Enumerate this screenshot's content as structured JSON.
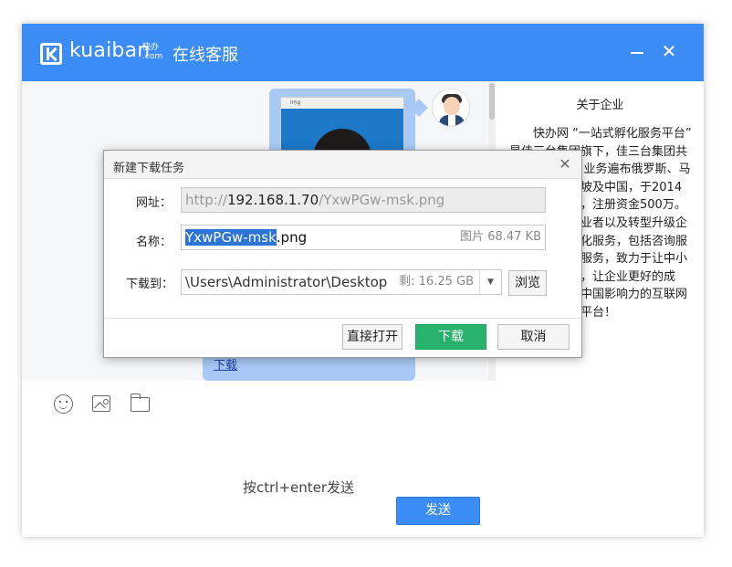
{
  "app": {
    "logo_text": "kuaiban",
    "logo_sub_line1": "快办",
    "logo_sub_line2": ".com",
    "title": "在线客服",
    "accent": "#3b8cf4"
  },
  "chat": {
    "image_window_title": "img",
    "link_text": "下载"
  },
  "about": {
    "title": "关于企业",
    "body": "快办网 “一站式孵化服务平台” 是佳三台集团旗下，佳三台集团共12家子公司，业务遍布俄罗斯、马来西亚、新加坡及中国，于2014年在上海成立，注册资金500万。平台为行业创业者以及转型升级企业提供定位孵化服务，包括咨询服务、企业孵化服务，致力于让中小企业良性发展，让企业更好的成长，成为具有中国影响力的互联网企业孵化服务平台！"
  },
  "toolbar": {
    "icons": [
      "smile-icon",
      "picture-icon",
      "folder-icon"
    ]
  },
  "composer": {
    "hint": "按ctrl+enter发送",
    "send_label": "发送"
  },
  "dialog": {
    "title": "新建下载任务",
    "url_label": "网址：",
    "url_prefix": "http://",
    "url_host": "192.168.1.70",
    "url_path": "/YxwPGw-msk.png",
    "name_label": "名称：",
    "name_selected": "YxwPGw-msk",
    "name_ext": ".png",
    "name_meta": "图片 68.47 KB",
    "dir_label": "下载到：",
    "dir_value": "\\Users\\Administrator\\Desktop",
    "dir_meta": "剩: 16.25 GB",
    "browse_label": "浏览",
    "open_label": "直接打开",
    "download_label": "下载",
    "cancel_label": "取消",
    "download_color": "#29b26b"
  }
}
